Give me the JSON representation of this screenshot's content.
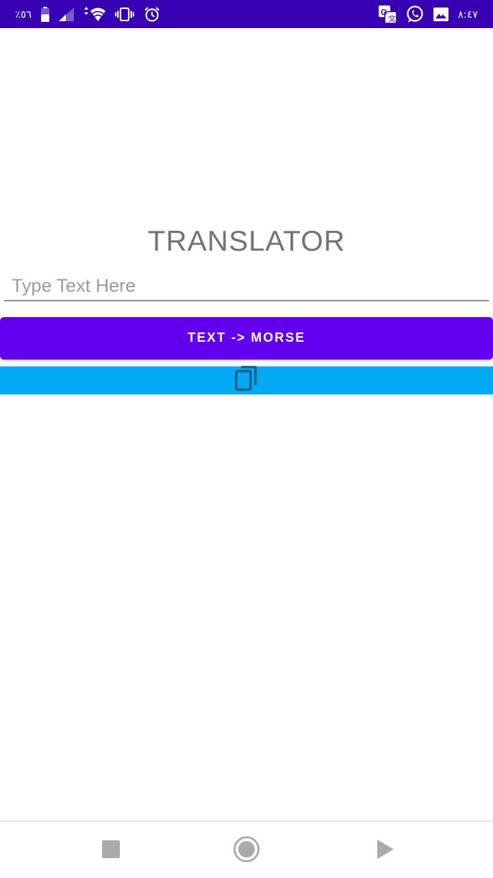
{
  "status_bar": {
    "background": "#3700b3",
    "battery_text": "٪٥٦",
    "time": "٨:٤٧",
    "left_icons": [
      "battery-icon",
      "signal-icon",
      "wifi-icon",
      "vibrate-icon",
      "alarm-icon"
    ],
    "right_icons": [
      "translate-icon",
      "whatsapp-icon",
      "image-icon"
    ]
  },
  "app": {
    "title": "TRANSLATOR",
    "input": {
      "placeholder": "Type Text Here",
      "value": ""
    },
    "primary_button_label": "TEXT -> MORSE",
    "primary_button_color": "#6200ee",
    "output_bar_color": "#03a9f4",
    "output_icon": "copy-icon"
  },
  "nav_bar": {
    "buttons": [
      "recents-button",
      "home-button",
      "back-button"
    ]
  }
}
